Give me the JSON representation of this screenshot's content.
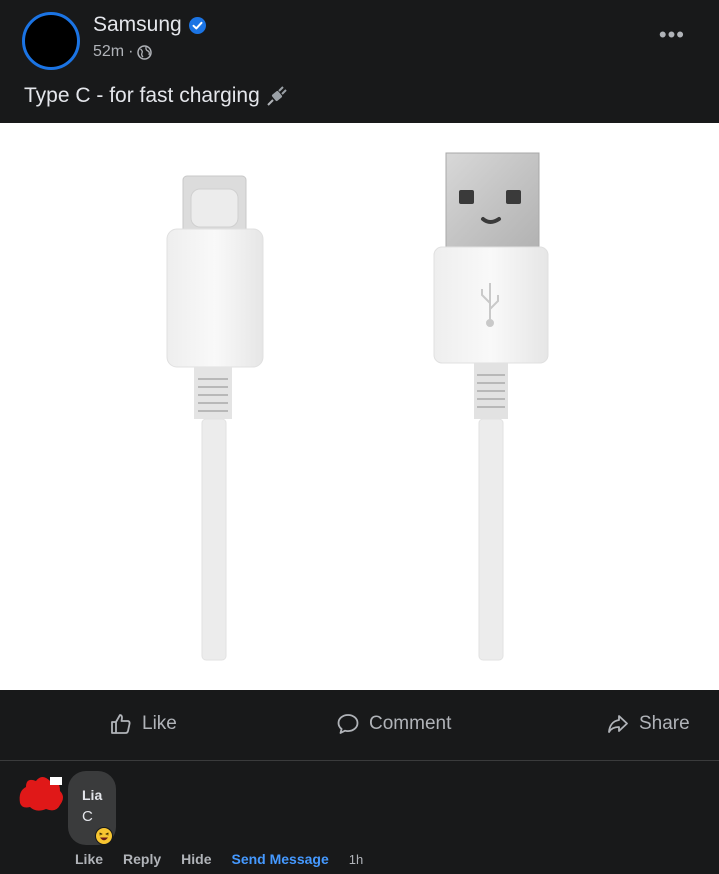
{
  "post": {
    "author": "Samsung",
    "time": "52m",
    "meta_separator": "·",
    "caption": "Type C - for fast charging",
    "more_label": "•••"
  },
  "actions": {
    "like": "Like",
    "comment": "Comment",
    "share": "Share"
  },
  "comment": {
    "author": "Lia",
    "text": "C",
    "actions": {
      "like": "Like",
      "reply": "Reply",
      "hide": "Hide",
      "send_message": "Send Message",
      "time": "1h"
    }
  },
  "icons": {
    "verified": "verified-badge-icon",
    "globe": "globe-icon",
    "plug": "electric-plug-icon",
    "like": "thumbs-up-icon",
    "comment": "speech-bubble-icon",
    "share": "share-arrow-icon",
    "reaction": "laughing-emoji-icon"
  },
  "colors": {
    "background": "#18191a",
    "accent": "#1b74e4",
    "link": "#4599ff",
    "secondary_text": "#b0b3b8"
  }
}
